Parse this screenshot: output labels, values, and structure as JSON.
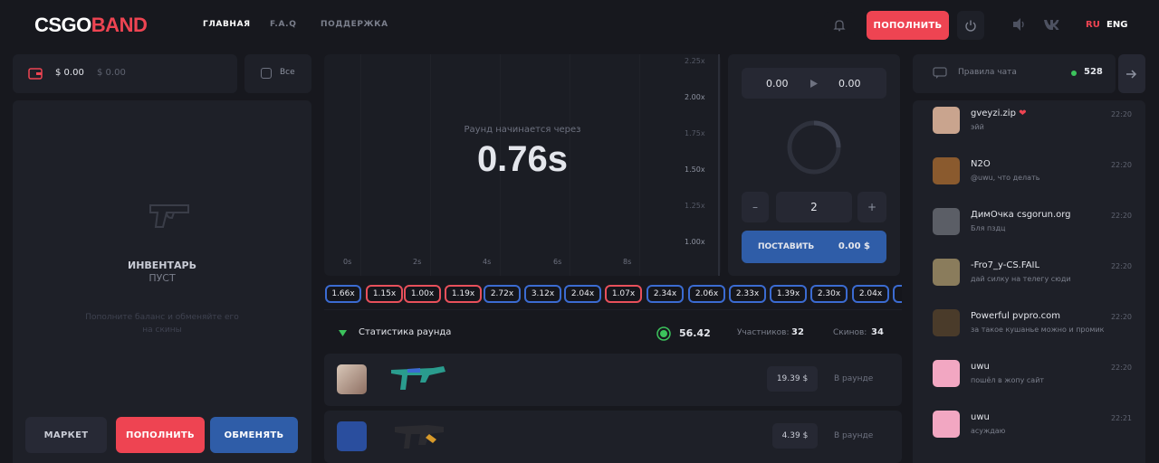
{
  "header": {
    "logo_a": "CSGO",
    "logo_b": "BAND",
    "nav": [
      "ГЛАВНАЯ",
      "F.A.Q",
      "ПОДДЕРЖКА"
    ],
    "deposit_label": "ПОПОЛНИТЬ",
    "lang_ru": "RU",
    "lang_eng": "ENG"
  },
  "balance": {
    "primary": "$ 0.00",
    "secondary": "$ 0.00",
    "all_label": "Все"
  },
  "inventory": {
    "title": "ИНВЕНТАРЬ",
    "subtitle": "ПУСТ",
    "hint_line1": "Пополните баланс и обменяйте его",
    "hint_line2": "на скины",
    "market_label": "МАРКЕТ",
    "deposit_label": "ПОПОЛНИТЬ",
    "exchange_label": "ОБМЕНЯТЬ"
  },
  "game": {
    "round_label": "Раунд начинается через",
    "countdown": "0.76s",
    "y_ticks": [
      "2.25x",
      "2.00x",
      "1.75x",
      "1.50x",
      "1.25x",
      "1.00x"
    ],
    "x_ticks": [
      "0s",
      "2s",
      "4s",
      "6s",
      "8s"
    ]
  },
  "bet": {
    "auto_from": "0.00",
    "auto_to": "0.00",
    "minus": "–",
    "amount": "2",
    "plus": "+",
    "place_label": "ПОСТАВИТЬ",
    "place_value": "0.00 $"
  },
  "history": [
    {
      "v": "1.66x",
      "c": "blue"
    },
    {
      "v": "1.15x",
      "c": "red"
    },
    {
      "v": "1.00x",
      "c": "red"
    },
    {
      "v": "1.19x",
      "c": "red"
    },
    {
      "v": "2.72x",
      "c": "blue"
    },
    {
      "v": "3.12x",
      "c": "blue"
    },
    {
      "v": "2.04x",
      "c": "blue"
    },
    {
      "v": "1.07x",
      "c": "red"
    },
    {
      "v": "2.34x",
      "c": "blue"
    },
    {
      "v": "2.06x",
      "c": "blue"
    },
    {
      "v": "2.33x",
      "c": "blue"
    },
    {
      "v": "1.39x",
      "c": "blue"
    },
    {
      "v": "2.30x",
      "c": "blue"
    },
    {
      "v": "2.04x",
      "c": "blue"
    }
  ],
  "stats": {
    "title": "Статистика раунда",
    "bank": "56.42",
    "players_label": "Участников:",
    "players": "32",
    "skins_label": "Скинов:",
    "skins": "34"
  },
  "bets": [
    {
      "price": "19.39 $",
      "status": "В раунде"
    },
    {
      "price": "4.39 $",
      "status": "В раунде"
    }
  ],
  "chat": {
    "rules_label": "Правила чата",
    "online": "528",
    "messages": [
      {
        "name": "gveyzi.zip",
        "heart": "❤",
        "msg": "эйй",
        "time": "22:20",
        "color": "#c9a48e"
      },
      {
        "name": "N2O",
        "heart": "",
        "msg": "@uwu, что делать",
        "time": "22:20",
        "color": "#8a5a2e"
      },
      {
        "name": "ДимОчка csgorun.org",
        "heart": "",
        "msg": "Бля пздц",
        "time": "22:20",
        "color": "#5b5e66"
      },
      {
        "name": "-Fro7_y-CS.FAIL",
        "heart": "",
        "msg": "дай силку на телегу сюди",
        "time": "22:20",
        "color": "#8a7c5c"
      },
      {
        "name": "Powerful pvpro.com",
        "heart": "",
        "msg": "за такое кушанье можно и промик",
        "time": "22:20",
        "color": "#4a3b2a"
      },
      {
        "name": "uwu",
        "heart": "",
        "msg": "пошёл в жопу сайт",
        "time": "22:20",
        "color": "#f2a7c2"
      },
      {
        "name": "uwu",
        "heart": "",
        "msg": "асуждаю",
        "time": "22:21",
        "color": "#f2a7c2"
      }
    ]
  },
  "colors": {
    "accent_red": "#ee4452",
    "accent_blue": "#2f5da8",
    "bg": "#17181e",
    "card": "#1e2028",
    "online_green": "#3cc35c"
  }
}
